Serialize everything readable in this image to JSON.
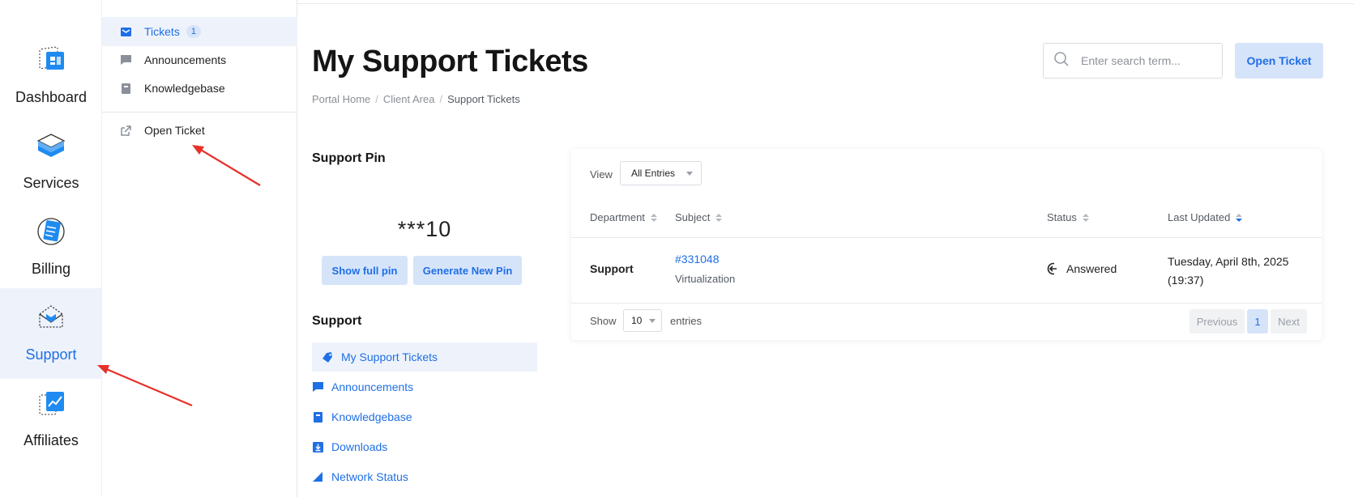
{
  "rail": {
    "items": [
      {
        "label": "Dashboard",
        "icon": "dashboard-icon"
      },
      {
        "label": "Services",
        "icon": "services-icon"
      },
      {
        "label": "Billing",
        "icon": "billing-icon"
      },
      {
        "label": "Support",
        "icon": "support-icon",
        "active": true
      },
      {
        "label": "Affiliates",
        "icon": "affiliates-icon"
      }
    ]
  },
  "submenu": {
    "items": [
      {
        "label": "Tickets",
        "badge": "1",
        "icon": "envelope-icon",
        "active": true
      },
      {
        "label": "Announcements",
        "icon": "comment-icon"
      },
      {
        "label": "Knowledgebase",
        "icon": "book-icon"
      },
      {
        "label": "Open Ticket",
        "icon": "external-link-icon"
      }
    ]
  },
  "header": {
    "title": "My Support Tickets",
    "breadcrumb": [
      "Portal Home",
      "Client Area",
      "Support Tickets"
    ],
    "search_placeholder": "Enter search term...",
    "open_ticket_label": "Open Ticket"
  },
  "pin": {
    "title": "Support Pin",
    "value": "***10",
    "show_label": "Show full pin",
    "generate_label": "Generate New Pin"
  },
  "support_nav": {
    "title": "Support",
    "items": [
      {
        "label": "My Support Tickets",
        "icon": "tag-icon",
        "active": true
      },
      {
        "label": "Announcements",
        "icon": "comment-icon"
      },
      {
        "label": "Knowledgebase",
        "icon": "book-icon"
      },
      {
        "label": "Downloads",
        "icon": "download-icon"
      },
      {
        "label": "Network Status",
        "icon": "signal-icon"
      }
    ]
  },
  "table": {
    "view_label": "View",
    "view_value": "All Entries",
    "columns": [
      "Department",
      "Subject",
      "Status",
      "Last Updated"
    ],
    "rows": [
      {
        "department": "Support",
        "ticket_id": "#331048",
        "subject": "Virtualization",
        "status": "Answered",
        "last_updated_line1": "Tuesday, April 8th, 2025",
        "last_updated_line2": "(19:37)"
      }
    ],
    "show_label": "Show",
    "length_value": "10",
    "entries_label": "entries",
    "pagination": {
      "previous": "Previous",
      "page": "1",
      "next": "Next"
    }
  },
  "colors": {
    "accent": "#1f6fe5",
    "active_bg": "#eef3fb",
    "button_bg": "#d6e4fa",
    "annotation_arrow": "#e8302a"
  }
}
